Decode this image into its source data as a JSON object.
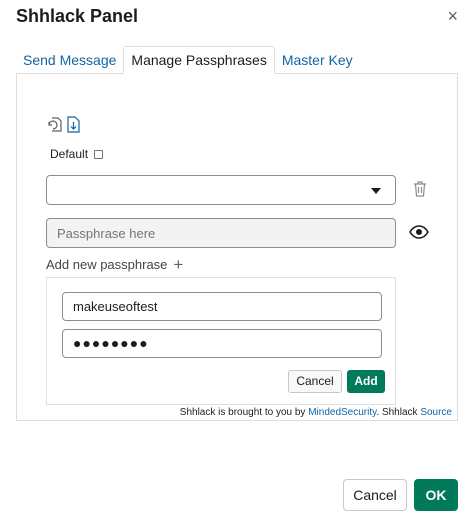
{
  "dialog": {
    "title": "Shhlack Panel",
    "close_glyph": "×"
  },
  "tabs": [
    {
      "label": "Send Message",
      "active": false
    },
    {
      "label": "Manage Passphrases",
      "active": true
    },
    {
      "label": "Master Key",
      "active": false
    }
  ],
  "manage": {
    "icons": [
      "import-icon",
      "export-icon"
    ],
    "default_label": "Default",
    "default_checked": false,
    "select_value": "",
    "passphrase_placeholder": "Passphrase here",
    "add_label": "Add new passphrase",
    "add_glyph": "+"
  },
  "new_entry": {
    "name_value": "makeuseoftest",
    "password_masked": "●●●●●●●●",
    "cancel_label": "Cancel",
    "add_label": "Add"
  },
  "footer": {
    "text": "Shhlack is brought to you by ",
    "author_link": "MindedSecurity",
    "middle": ". Shhlack ",
    "source_link": "Source"
  },
  "actions": {
    "cancel_label": "Cancel",
    "ok_label": "OK"
  },
  "colors": {
    "link": "#1264a3",
    "primary": "#007a5a"
  }
}
